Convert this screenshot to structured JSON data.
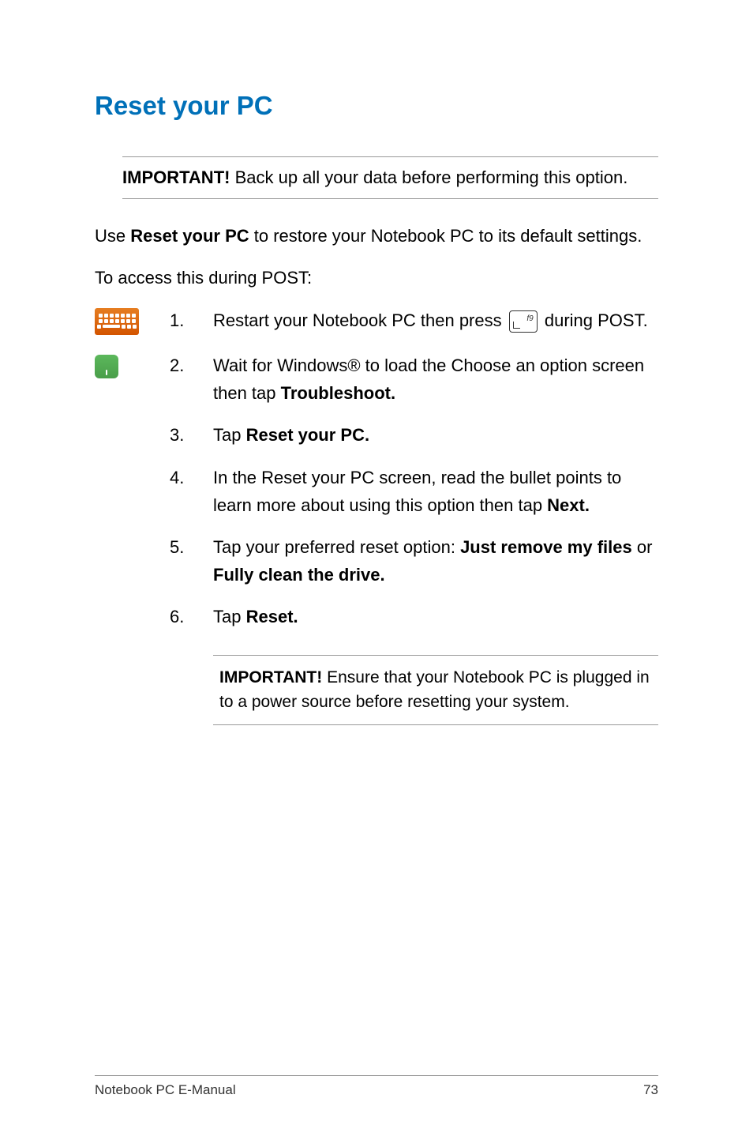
{
  "heading": "Reset your PC",
  "important_top": {
    "label": "IMPORTANT!",
    "text": " Back up all your data before performing this option."
  },
  "intro": {
    "prefix": "Use ",
    "bold": "Reset your PC",
    "suffix": " to restore your Notebook PC to its default settings."
  },
  "access_line": "To access this during POST:",
  "steps": {
    "s1_prefix": "Restart your Notebook PC then press ",
    "s1_key_label": "f9",
    "s1_suffix": " during POST.",
    "s2_prefix": "Wait for Windows® to load the Choose an option screen then tap ",
    "s2_bold": "Troubleshoot.",
    "s3_prefix": "Tap ",
    "s3_bold": "Reset your PC.",
    "s4_prefix": "In the Reset your PC screen, read the bullet points to learn more about using this option then tap ",
    "s4_bold": "Next.",
    "s5_prefix": "Tap your preferred reset option: ",
    "s5_bold1": "Just remove my files",
    "s5_mid": " or ",
    "s5_bold2": "Fully clean the drive.",
    "s6_prefix": "Tap ",
    "s6_bold": "Reset."
  },
  "important_bottom": {
    "label": "IMPORTANT!",
    "text": " Ensure that your Notebook PC is plugged in to a power source before resetting your system."
  },
  "footer": {
    "left": "Notebook PC E-Manual",
    "right": "73"
  }
}
